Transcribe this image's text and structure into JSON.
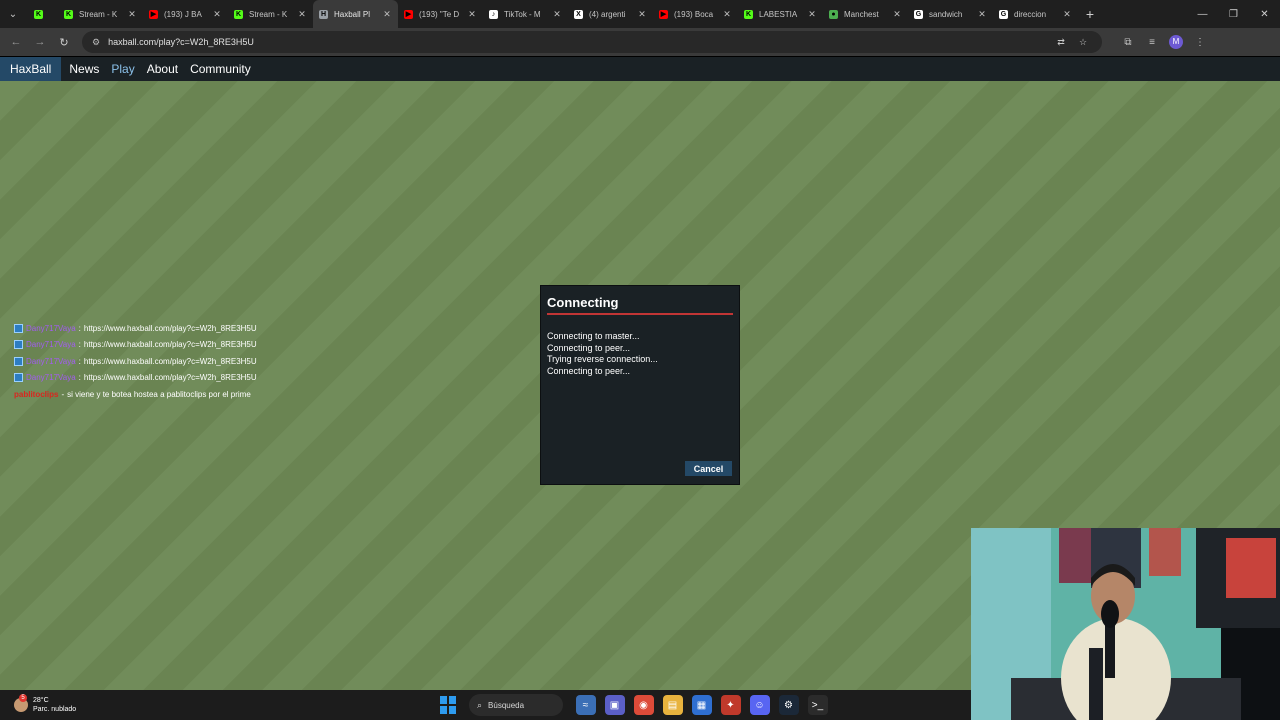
{
  "browser": {
    "tabs": [
      {
        "title": "",
        "favicon": "kick-logo-icon",
        "color": "#53fc18",
        "pinned": true,
        "active": false
      },
      {
        "title": "Stream - K",
        "favicon": "kick-logo-icon",
        "color": "#53fc18",
        "active": false
      },
      {
        "title": "(193) J BA",
        "favicon": "youtube-icon",
        "color": "#ff0000",
        "active": false
      },
      {
        "title": "Stream - K",
        "favicon": "kick-logo-icon",
        "color": "#53fc18",
        "active": false
      },
      {
        "title": "Haxball Pl",
        "favicon": "haxball-icon",
        "color": "#9aa0a6",
        "active": true
      },
      {
        "title": "(193) \"Te D",
        "favicon": "youtube-icon",
        "color": "#ff0000",
        "active": false
      },
      {
        "title": "TikTok - M",
        "favicon": "tiktok-icon",
        "color": "#ffffff",
        "active": false
      },
      {
        "title": "(4) argenti",
        "favicon": "x-icon",
        "color": "#ffffff",
        "active": false
      },
      {
        "title": "(193) Boca",
        "favicon": "youtube-icon",
        "color": "#ff0000",
        "active": false
      },
      {
        "title": "LABESTIA",
        "favicon": "kick-logo-icon",
        "color": "#53fc18",
        "active": false
      },
      {
        "title": "Manchest",
        "favicon": "soccer-icon",
        "color": "#4caf50",
        "active": false
      },
      {
        "title": "sandwich",
        "favicon": "google-icon",
        "color": "#ffffff",
        "active": false
      },
      {
        "title": "direccion",
        "favicon": "google-icon",
        "color": "#ffffff",
        "active": false
      }
    ],
    "url": "haxball.com/play?c=W2h_8RE3H5U",
    "profile_initial": "M"
  },
  "site": {
    "brand": "HaxBall",
    "nav": [
      "News",
      "Play",
      "About",
      "Community"
    ],
    "current_nav": "Play"
  },
  "chat": [
    {
      "user": "Dany717Vaya",
      "message": "https://www.haxball.com/play?c=W2h_8RE3H5U",
      "user_color": "#a25cf0"
    },
    {
      "user": "Dany717Vaya",
      "message": "https://www.haxball.com/play?c=W2h_8RE3H5U",
      "user_color": "#a25cf0"
    },
    {
      "user": "Dany717Vaya",
      "message": "https://www.haxball.com/play?c=W2h_8RE3H5U",
      "user_color": "#a25cf0"
    },
    {
      "user": "Dany717Vaya",
      "message": "https://www.haxball.com/play?c=W2h_8RE3H5U",
      "user_color": "#a25cf0"
    },
    {
      "user": "pablitoclips",
      "message": "si viene y te botea hostea a pablitoclips por el prime",
      "user_color": "#d9261f"
    }
  ],
  "dialog": {
    "title": "Connecting",
    "log": [
      "Connecting to master...",
      "Connecting to peer...",
      "Trying reverse connection...",
      "Connecting to peer..."
    ],
    "cancel_label": "Cancel",
    "accent_color": "#c13535"
  },
  "taskbar": {
    "weather_temp": "28°C",
    "weather_desc": "Parc. nublado",
    "notification_count": "5",
    "search_placeholder": "Búsqueda",
    "apps": [
      "edge-surf-icon",
      "teams-chat-icon",
      "chrome-icon",
      "file-explorer-icon",
      "store-icon",
      "app-icon",
      "discord-icon",
      "steam-icon",
      "terminal-icon"
    ]
  },
  "colors": {
    "field_light": "#718c5a",
    "field_dark": "#6a8452",
    "haxball_blue": "#244967",
    "panel_dark": "#1a2125"
  }
}
